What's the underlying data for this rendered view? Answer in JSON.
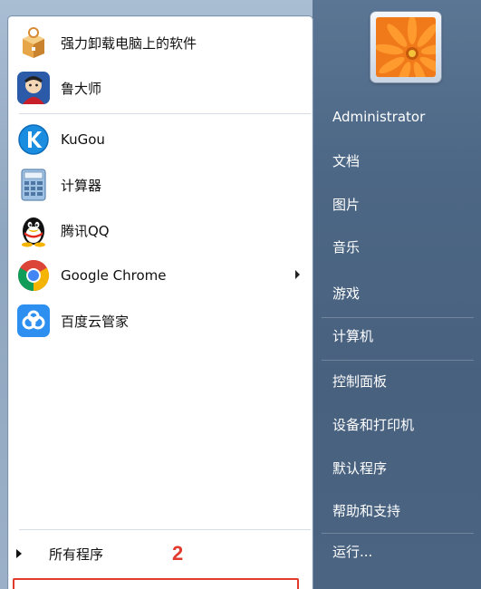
{
  "left_pane": {
    "pinned": [
      {
        "label": "强力卸载电脑上的软件",
        "icon": "uninstall-box-icon"
      },
      {
        "label": "鲁大师",
        "icon": "ludashi-icon"
      }
    ],
    "recent": [
      {
        "label": "KuGou",
        "icon": "kugou-icon"
      },
      {
        "label": "计算器",
        "icon": "calculator-icon"
      },
      {
        "label": "腾讯QQ",
        "icon": "qq-penguin-icon"
      },
      {
        "label": "Google Chrome",
        "icon": "chrome-icon",
        "has_submenu": true
      },
      {
        "label": "百度云管家",
        "icon": "baidu-cloud-icon"
      }
    ],
    "all_programs_label": "所有程序",
    "annotation": "2"
  },
  "right_pane": {
    "user_name": "Administrator",
    "items": [
      "文档",
      "图片",
      "音乐",
      "游戏",
      "计算机",
      "控制面板",
      "设备和打印机",
      "默认程序",
      "帮助和支持",
      "运行..."
    ]
  },
  "colors": {
    "annotation_red": "#e23b2e",
    "right_pane_blue": "#4c6785"
  }
}
